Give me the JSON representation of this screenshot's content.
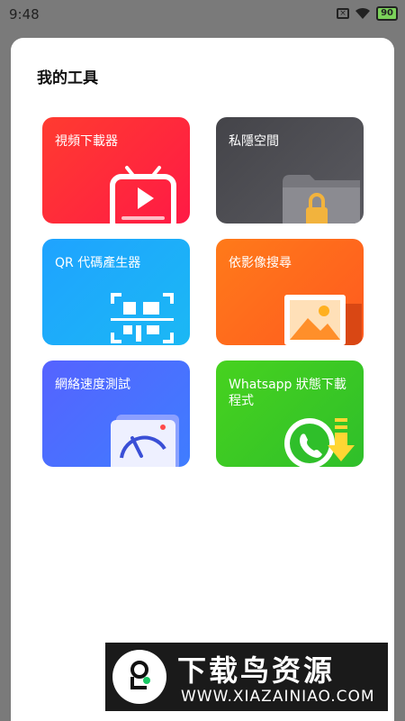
{
  "status_bar": {
    "time": "9:48",
    "battery_level": "90"
  },
  "sheet": {
    "title": "我的工具"
  },
  "tools": [
    {
      "label": "視頻下載器",
      "icon": "video-download-icon"
    },
    {
      "label": "私隱空間",
      "icon": "locked-folder-icon"
    },
    {
      "label": "QR 代碼產生器",
      "icon": "qr-code-icon"
    },
    {
      "label": "依影像搜尋",
      "icon": "image-search-icon"
    },
    {
      "label": "網絡速度測試",
      "icon": "speedometer-icon"
    },
    {
      "label": "Whatsapp 狀態下載程式",
      "icon": "whatsapp-download-icon"
    }
  ],
  "watermark": {
    "title": "下载鸟资源",
    "url": "WWW.XIAZAINIAO.COM"
  }
}
